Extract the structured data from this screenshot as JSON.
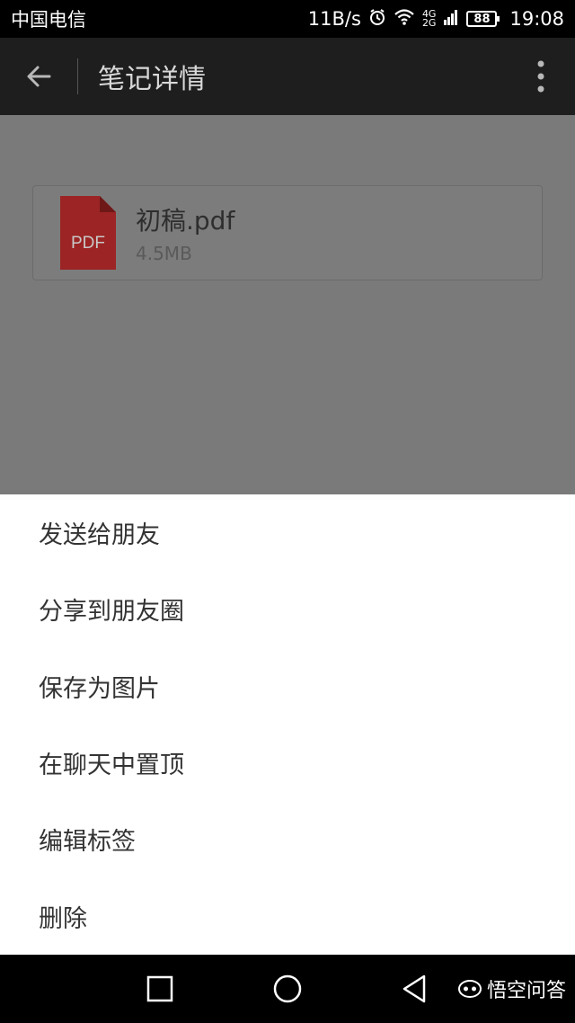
{
  "status_bar": {
    "carrier": "中国电信",
    "net_speed": "11B/s",
    "network_top": "4G",
    "network_bottom": "2G",
    "battery": "88",
    "time": "19:08"
  },
  "app_bar": {
    "title": "笔记详情"
  },
  "file": {
    "icon_label": "PDF",
    "name": "初稿.pdf",
    "size": "4.5MB"
  },
  "menu": {
    "items": [
      {
        "label": "发送给朋友"
      },
      {
        "label": "分享到朋友圈"
      },
      {
        "label": "保存为图片"
      },
      {
        "label": "在聊天中置顶"
      },
      {
        "label": "编辑标签"
      },
      {
        "label": "删除"
      }
    ]
  },
  "watermark": {
    "text": "悟空问答"
  },
  "colors": {
    "pdf_red": "#9c2424",
    "overlay_gray": "#7a7a7a",
    "app_bar": "#1e1e1e"
  }
}
